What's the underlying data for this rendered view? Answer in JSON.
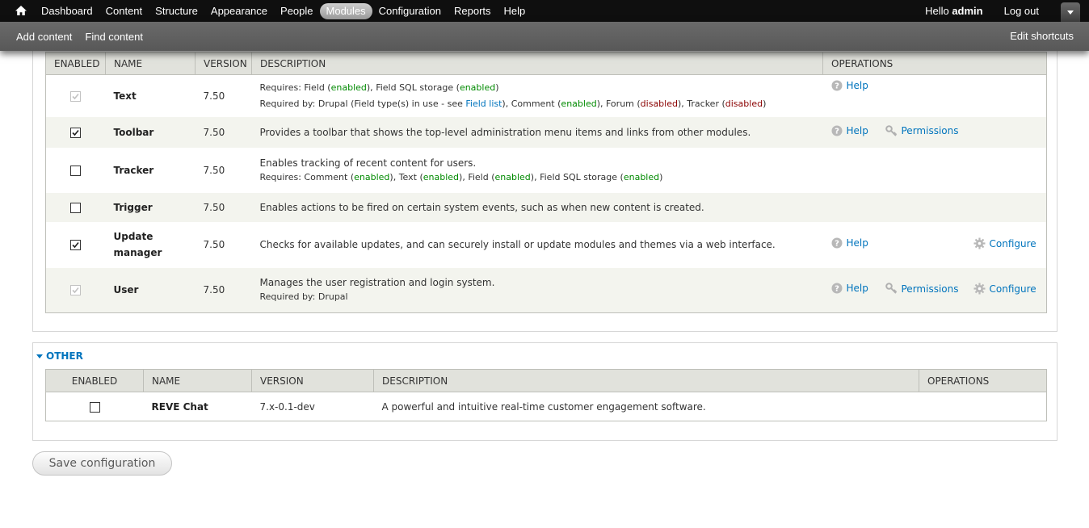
{
  "toolbar": {
    "menu": [
      "Dashboard",
      "Content",
      "Structure",
      "Appearance",
      "People",
      "Modules",
      "Configuration",
      "Reports",
      "Help"
    ],
    "active_menu": "Modules",
    "hello_prefix": "Hello ",
    "user_name": "admin",
    "logout": "Log out",
    "shortcuts": [
      "Add content",
      "Find content"
    ],
    "edit_shortcuts": "Edit shortcuts"
  },
  "core_table": {
    "headers": {
      "enabled": "ENABLED",
      "name": "NAME",
      "version": "VERSION",
      "description": "DESCRIPTION",
      "operations": "OPERATIONS"
    },
    "rows": {
      "text": {
        "name": "Text",
        "version": "7.50",
        "requires_label": "Requires: ",
        "requires": [
          {
            "name": "Field",
            "status": "enabled"
          },
          {
            "name": "Field SQL storage",
            "status": "enabled"
          }
        ],
        "required_by_prefix": "Required by: Drupal (Field type(s) in use - see ",
        "field_list_link": "Field list",
        "required_by_suffix": "), ",
        "required_by": [
          {
            "name": "Comment",
            "status": "enabled"
          },
          {
            "name": "Forum",
            "status": "disabled"
          },
          {
            "name": "Tracker",
            "status": "disabled"
          }
        ],
        "help": "Help"
      },
      "toolbar_mod": {
        "name": "Toolbar",
        "version": "7.50",
        "description": "Provides a toolbar that shows the top-level administration menu items and links from other modules.",
        "help": "Help",
        "permissions": "Permissions"
      },
      "tracker": {
        "name": "Tracker",
        "version": "7.50",
        "description": "Enables tracking of recent content for users.",
        "requires_label": "Requires: ",
        "requires": [
          {
            "name": "Comment",
            "status": "enabled"
          },
          {
            "name": "Text",
            "status": "enabled"
          },
          {
            "name": "Field",
            "status": "enabled"
          },
          {
            "name": "Field SQL storage",
            "status": "enabled"
          }
        ]
      },
      "trigger": {
        "name": "Trigger",
        "version": "7.50",
        "description": "Enables actions to be fired on certain system events, such as when new content is created."
      },
      "update": {
        "name_line1": "Update",
        "name_line2": "manager",
        "version": "7.50",
        "description": "Checks for available updates, and can securely install or update modules and themes via a web interface.",
        "help": "Help",
        "configure": "Configure"
      },
      "user": {
        "name": "User",
        "version": "7.50",
        "description": "Manages the user registration and login system.",
        "required_by": "Required by: Drupal",
        "help": "Help",
        "permissions": "Permissions",
        "configure": "Configure"
      }
    }
  },
  "other": {
    "legend": "OTHER",
    "headers": {
      "enabled": "ENABLED",
      "name": "NAME",
      "version": "VERSION",
      "description": "DESCRIPTION",
      "operations": "OPERATIONS"
    },
    "row": {
      "name": "REVE Chat",
      "version": "7.x-0.1-dev",
      "description": "A powerful and intuitive real-time customer engagement software."
    }
  },
  "save_button": "Save configuration",
  "colors": {
    "link": "#0074bd",
    "enabled": "#008a00",
    "disabled": "#8a0000",
    "toolbar_bg": "#0f0f0f",
    "shortcuts_bg": "#666666"
  }
}
